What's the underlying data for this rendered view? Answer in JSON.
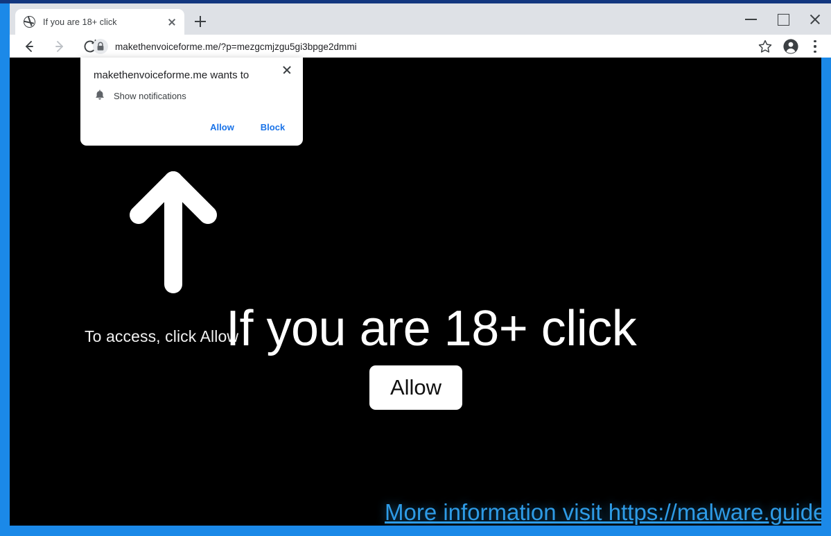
{
  "browser": {
    "tab": {
      "title": "If you are 18+ click",
      "favicon_icon": "globe-icon",
      "close_icon": "close-icon"
    },
    "new_tab_icon": "plus-icon",
    "window_controls": {
      "minimize_icon": "minimize-icon",
      "maximize_icon": "maximize-icon",
      "close_icon": "close-icon"
    },
    "toolbar": {
      "back_icon": "back-arrow-icon",
      "forward_icon": "forward-arrow-icon",
      "reload_icon": "reload-icon",
      "lock_icon": "lock-icon",
      "url": "makethenvoiceforme.me/?p=mezgcmjzgu5gi3bpge2dmmi",
      "star_icon": "star-icon",
      "profile_icon": "profile-avatar-icon",
      "menu_icon": "three-dot-menu-icon"
    }
  },
  "permission_dialog": {
    "title": "makethenvoiceforme.me wants to",
    "permission_icon": "bell-icon",
    "permission_label": "Show notifications",
    "allow_label": "Allow",
    "block_label": "Block",
    "close_icon": "close-icon"
  },
  "page": {
    "background_color": "#000000",
    "arrow_icon": "arrow-up-icon",
    "caption": "To access, click Allow",
    "headline": "If you are 18+ click",
    "allow_button_label": "Allow",
    "footer_link_text": "More information visit https://malware.guide",
    "footer_link_color": "#2e9be6",
    "text_color": "#ffffff"
  }
}
